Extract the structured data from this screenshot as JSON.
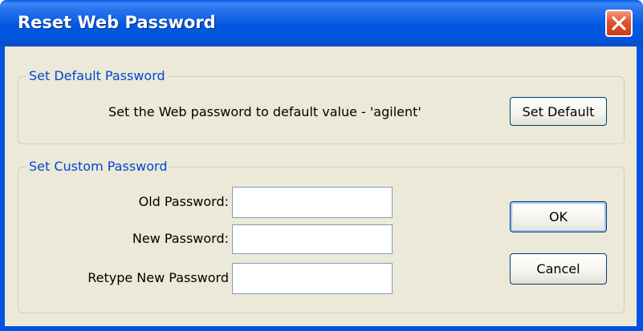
{
  "window": {
    "title": "Reset Web Password"
  },
  "default_group": {
    "title": "Set Default Password",
    "description": "Set the Web password to default value - 'agilent'",
    "set_default_label": "Set Default"
  },
  "custom_group": {
    "title": "Set Custom Password",
    "old_password_label": "Old Password:",
    "old_password_value": "",
    "new_password_label": "New Password:",
    "new_password_value": "",
    "retype_label": "Retype New Password",
    "retype_value": ""
  },
  "buttons": {
    "ok_label": "OK",
    "cancel_label": "Cancel"
  },
  "icons": {
    "close": "close-icon"
  },
  "colors": {
    "titlebar": "#0054e3",
    "close_button": "#e2532f",
    "group_title": "#0046d5",
    "client_background": "#ece9d8"
  }
}
